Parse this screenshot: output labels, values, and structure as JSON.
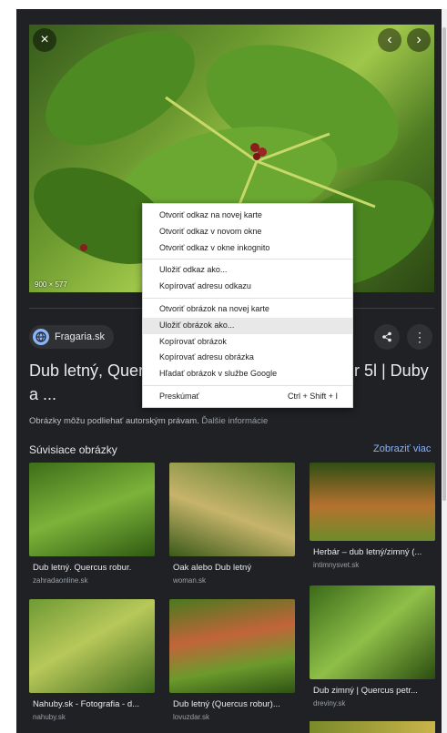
{
  "viewer": {
    "close_icon": "×",
    "prev_icon": "‹",
    "next_icon": "›",
    "dimensions": "900 × 577",
    "source_name": "Fragaria.sk",
    "share_icon": "share-icon",
    "more_icon": "⋮",
    "title_line1": "Dub letný, Querc",
    "title_tail": "r 5l | Duby",
    "title_line2": "a ...",
    "copyright": "Obrázky môžu podliehať autorským právam.",
    "copyright_link": "Ďalšie informácie"
  },
  "related": {
    "heading": "Súvisiace obrázky",
    "more": "Zobraziť viac",
    "items": [
      {
        "title": "Dub letný. Quercus robur.",
        "source": "zahradaonline.sk"
      },
      {
        "title": "Oak alebo Dub letný",
        "source": "woman.sk"
      },
      {
        "title": "Herbár – dub letný/zimný (...",
        "source": "intimnysvet.sk"
      },
      {
        "title": "Nahuby.sk - Fotografia - d...",
        "source": "nahuby.sk"
      },
      {
        "title": "Dub letný (Quercus robur)...",
        "source": "lovuzdar.sk"
      },
      {
        "title": "Dub zimný | Quercus petr...",
        "source": "dreviny.sk"
      }
    ]
  },
  "context_menu": {
    "items": [
      {
        "label": "Otvoriť odkaz na novej karte"
      },
      {
        "label": "Otvoriť odkaz v novom okne"
      },
      {
        "label": "Otvoriť odkaz v okne inkognito"
      },
      {
        "label": "Uložiť odkaz ako..."
      },
      {
        "label": "Kopírovať adresu odkazu"
      },
      {
        "label": "Otvoriť obrázok na novej karte"
      },
      {
        "label": "Uložiť obrázok ako..."
      },
      {
        "label": "Kopírovať obrázok"
      },
      {
        "label": "Kopírovať adresu obrázka"
      },
      {
        "label": "Hľadať obrázok v službe Google"
      },
      {
        "label": "Preskúmať",
        "shortcut": "Ctrl + Shift + I"
      }
    ]
  }
}
